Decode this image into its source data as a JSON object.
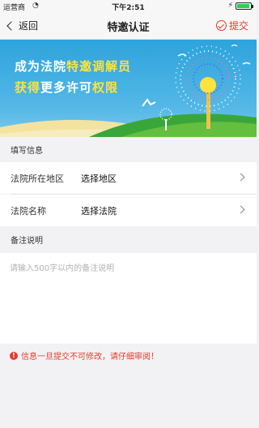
{
  "statusbar": {
    "carrier": "运营商",
    "time": "下午2:51"
  },
  "navbar": {
    "back_label": "返回",
    "title": "特邀认证",
    "submit_label": "提交"
  },
  "banner": {
    "line1_plain": "成为法院",
    "line1_highlight": "特邀调解员",
    "line2_highlight_a": "获得",
    "line2_plain": "更多许可",
    "line2_highlight_b": "权限"
  },
  "form": {
    "section_title": "填写信息",
    "rows": [
      {
        "label": "法院所在地区",
        "value": "选择地区"
      },
      {
        "label": "法院名称",
        "value": "选择法院"
      }
    ]
  },
  "remark": {
    "section_title": "备注说明",
    "placeholder": "请输入500字以内的备注说明"
  },
  "warning": {
    "text": "信息一旦提交不可修改，请仔细审阅！"
  },
  "colors": {
    "accent": "#e83a2a",
    "banner_blue": "#2ea3dc",
    "highlight_yellow": "#ffe23a"
  }
}
